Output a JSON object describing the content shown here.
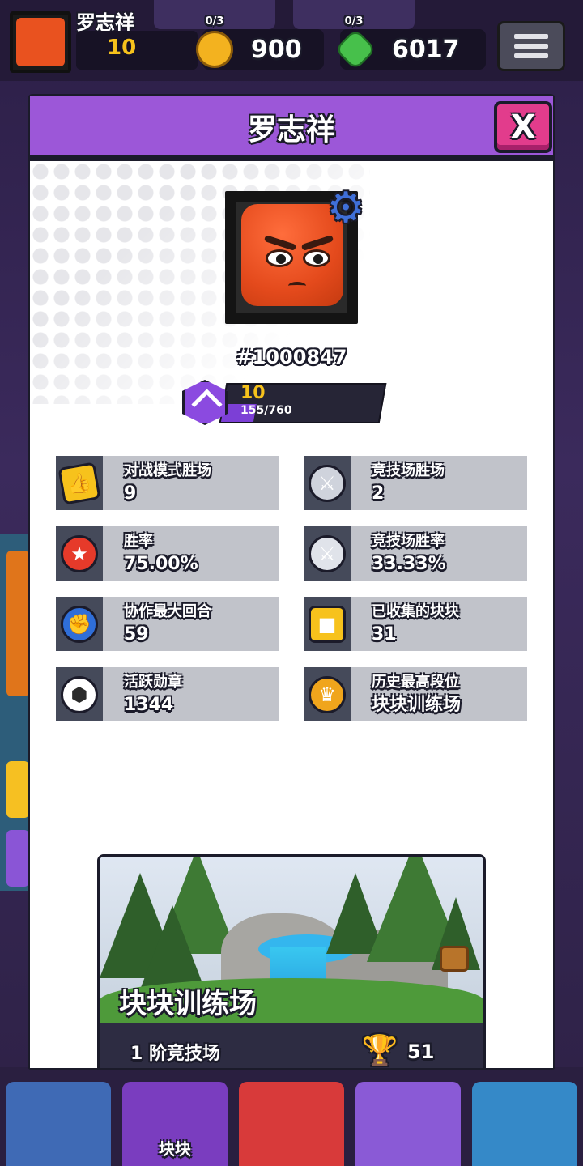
{
  "top_bar": {
    "player_name": "罗志祥",
    "level": "10",
    "tabs": [
      "0/3",
      "0/3"
    ],
    "coins": "900",
    "gems": "6017"
  },
  "modal": {
    "title": "罗志祥",
    "close_label": "X",
    "player_id": "#1000847",
    "level": "10",
    "xp": "155/760",
    "xp_progress": 0.204
  },
  "stats": [
    {
      "label": "对战模式胜场",
      "value": "9",
      "icon": "thumbs-up-icon"
    },
    {
      "label": "竞技场胜场",
      "value": "2",
      "icon": "crossed-swords-icon"
    },
    {
      "label": "胜率",
      "value": "75.00%",
      "icon": "win-rate-icon"
    },
    {
      "label": "竞技场胜率",
      "value": "33.33%",
      "icon": "arena-win-rate-icon"
    },
    {
      "label": "协作最大回合",
      "value": "59",
      "icon": "boxing-gloves-icon"
    },
    {
      "label": "已收集的块块",
      "value": "31",
      "icon": "block-face-icon"
    },
    {
      "label": "活跃勋章",
      "value": "1344",
      "icon": "activity-badge-icon"
    },
    {
      "label": "历史最高段位",
      "value": "块块训练场",
      "icon": "medal-icon"
    }
  ],
  "arena": {
    "name": "块块训练场",
    "tier": "1  阶竞技场",
    "trophies": "51"
  },
  "bottom_nav": {
    "active_label": "块块"
  }
}
